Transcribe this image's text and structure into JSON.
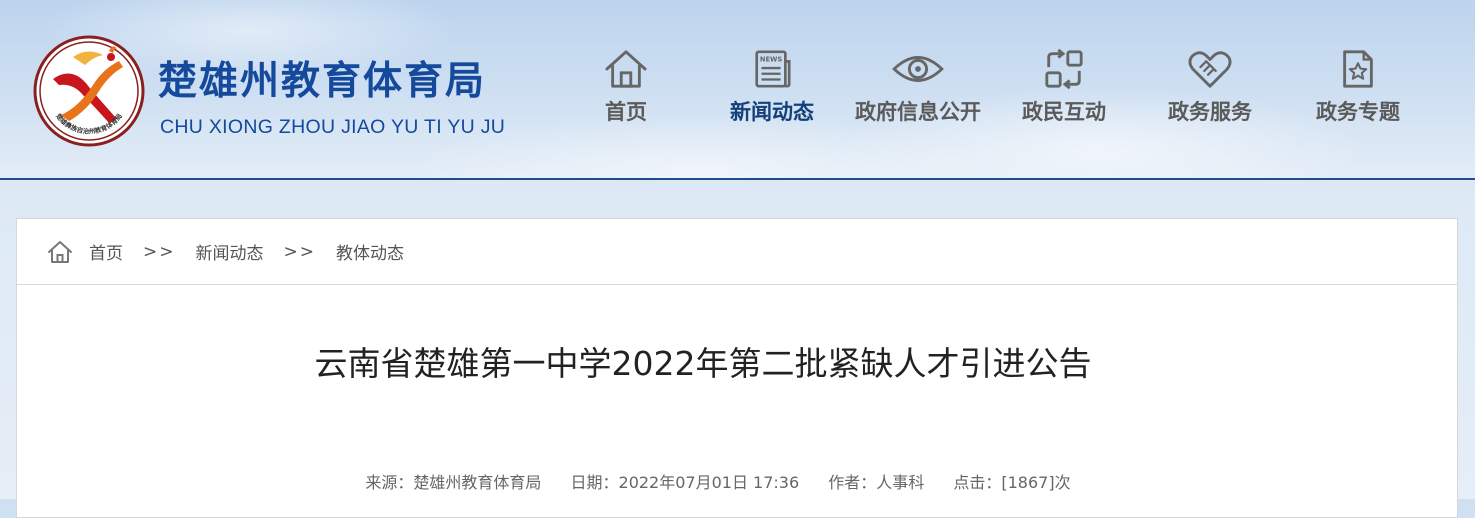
{
  "site": {
    "name_cn": "楚雄州教育体育局",
    "name_en": "CHU XIONG ZHOU JIAO YU TI YU JU",
    "logo_ring_text": "楚雄彝族自治州教育体育局"
  },
  "nav": [
    {
      "label": "首页",
      "icon": "home-icon",
      "active": false
    },
    {
      "label": "新闻动态",
      "icon": "newspaper-icon",
      "active": true
    },
    {
      "label": "政府信息公开",
      "icon": "eye-icon",
      "active": false
    },
    {
      "label": "政民互动",
      "icon": "interaction-icon",
      "active": false
    },
    {
      "label": "政务服务",
      "icon": "handshake-heart-icon",
      "active": false
    },
    {
      "label": "政务专题",
      "icon": "document-star-icon",
      "active": false
    }
  ],
  "breadcrumb": {
    "items": [
      "首页",
      "新闻动态",
      "教体动态"
    ],
    "separator": ">>"
  },
  "article": {
    "title": "云南省楚雄第一中学2022年第二批紧缺人才引进公告",
    "source": "来源：楚雄州教育体育局",
    "date": "日期：2022年07月01日 17:36",
    "author": "作者：人事科",
    "views": "点击：[1867]次"
  },
  "colors": {
    "brand_blue": "#14499b",
    "nav_text": "#5a5a5a",
    "nav_active": "#14407a",
    "header_rule": "#1d4f8c"
  },
  "nav_icon_glyph": {
    "newspaper": "NEWS"
  }
}
